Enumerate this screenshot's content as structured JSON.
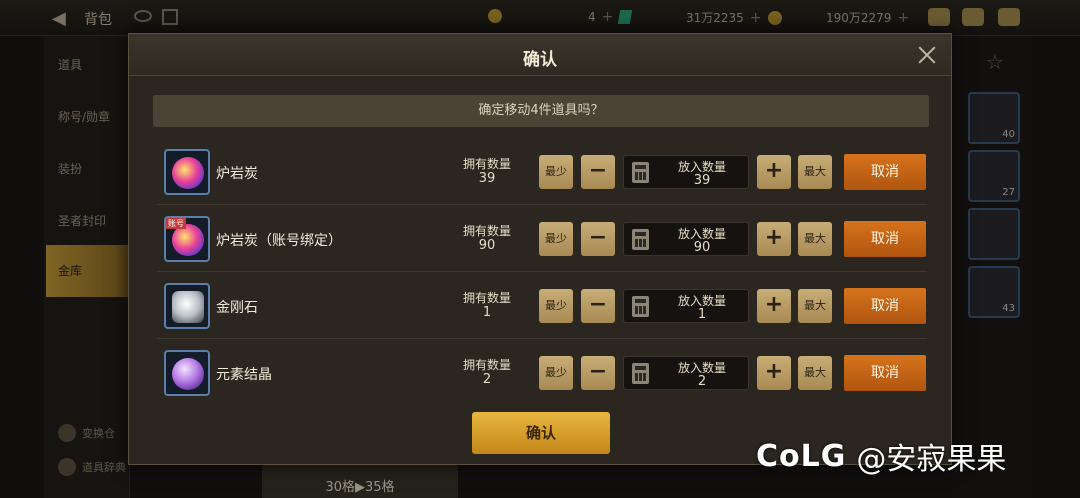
{
  "background": {
    "title": "背包",
    "resources": [
      {
        "icon": "coin-icon",
        "value": "4"
      },
      {
        "icon": "gem-icon",
        "value": "31万2235"
      },
      {
        "icon": "gold-icon",
        "value": "190万2279"
      }
    ],
    "sidebar": [
      "道具",
      "称号/勋章",
      "装扮",
      "圣者封印",
      "金库"
    ],
    "bottom_links": [
      "变换仓",
      "道具辞典"
    ],
    "capacity": "30格▶35格",
    "slot_counts": [
      "40",
      "27",
      "43"
    ]
  },
  "dialog": {
    "title": "确认",
    "prompt": "确定移动4件道具吗？",
    "own_label": "拥有数量",
    "put_label": "放入数量",
    "min_label": "最少",
    "max_label": "最大",
    "minus_label": "−",
    "plus_label": "+",
    "cancel_label": "取消",
    "confirm_label": "确认",
    "items": [
      {
        "name": "炉岩炭",
        "icon": "lava-coal-icon",
        "own": "39",
        "put": "39",
        "bound": false
      },
      {
        "name": "炉岩炭（账号绑定）",
        "icon": "lava-coal-bound-icon",
        "own": "90",
        "put": "90",
        "bound": true,
        "bind_tag": "账号"
      },
      {
        "name": "金刚石",
        "icon": "diamond-icon",
        "own": "1",
        "put": "1",
        "bound": false
      },
      {
        "name": "元素结晶",
        "icon": "element-crystal-icon",
        "own": "2",
        "put": "2",
        "bound": false
      }
    ]
  },
  "watermark": {
    "logo": "CoLG",
    "user": "@安寂果果"
  },
  "colors": {
    "accent_orange": "#c86414",
    "confirm_gold": "#d9a02c",
    "panel": "#2b2720"
  }
}
